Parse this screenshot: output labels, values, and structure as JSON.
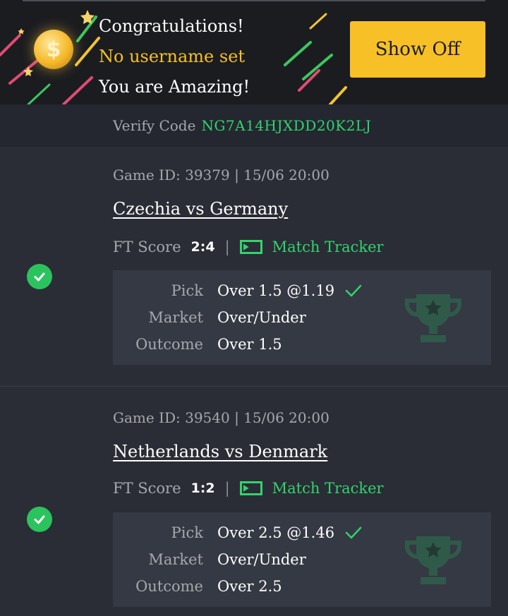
{
  "banner": {
    "line1": "Congratulations!",
    "line2": "No username set",
    "line3": "You are Amazing!",
    "button": "Show Off",
    "coin_symbol": "$"
  },
  "verify": {
    "label": "Verify Code",
    "code": "NG7A14HJXDD20K2LJ"
  },
  "bets": [
    {
      "game_meta": "Game ID: 39379 | 15/06 20:00",
      "match": "Czechia vs Germany",
      "score_label": "FT Score",
      "score": "2:4",
      "separator": "|",
      "tracker": "Match Tracker",
      "pick_label": "Pick",
      "pick": "Over 1.5 @1.19",
      "market_label": "Market",
      "market": "Over/Under",
      "outcome_label": "Outcome",
      "outcome": "Over 1.5"
    },
    {
      "game_meta": "Game ID: 39540 | 15/06 20:00",
      "match": "Netherlands vs Denmark",
      "score_label": "FT Score",
      "score": "1:2",
      "separator": "|",
      "tracker": "Match Tracker",
      "pick_label": "Pick",
      "pick": "Over 2.5 @1.46",
      "market_label": "Market",
      "market": "Over/Under",
      "outcome_label": "Outcome",
      "outcome": "Over 2.5"
    }
  ],
  "colors": {
    "accent_green": "#32d36e",
    "accent_yellow": "#f6c026",
    "background": "#2a2d35"
  }
}
